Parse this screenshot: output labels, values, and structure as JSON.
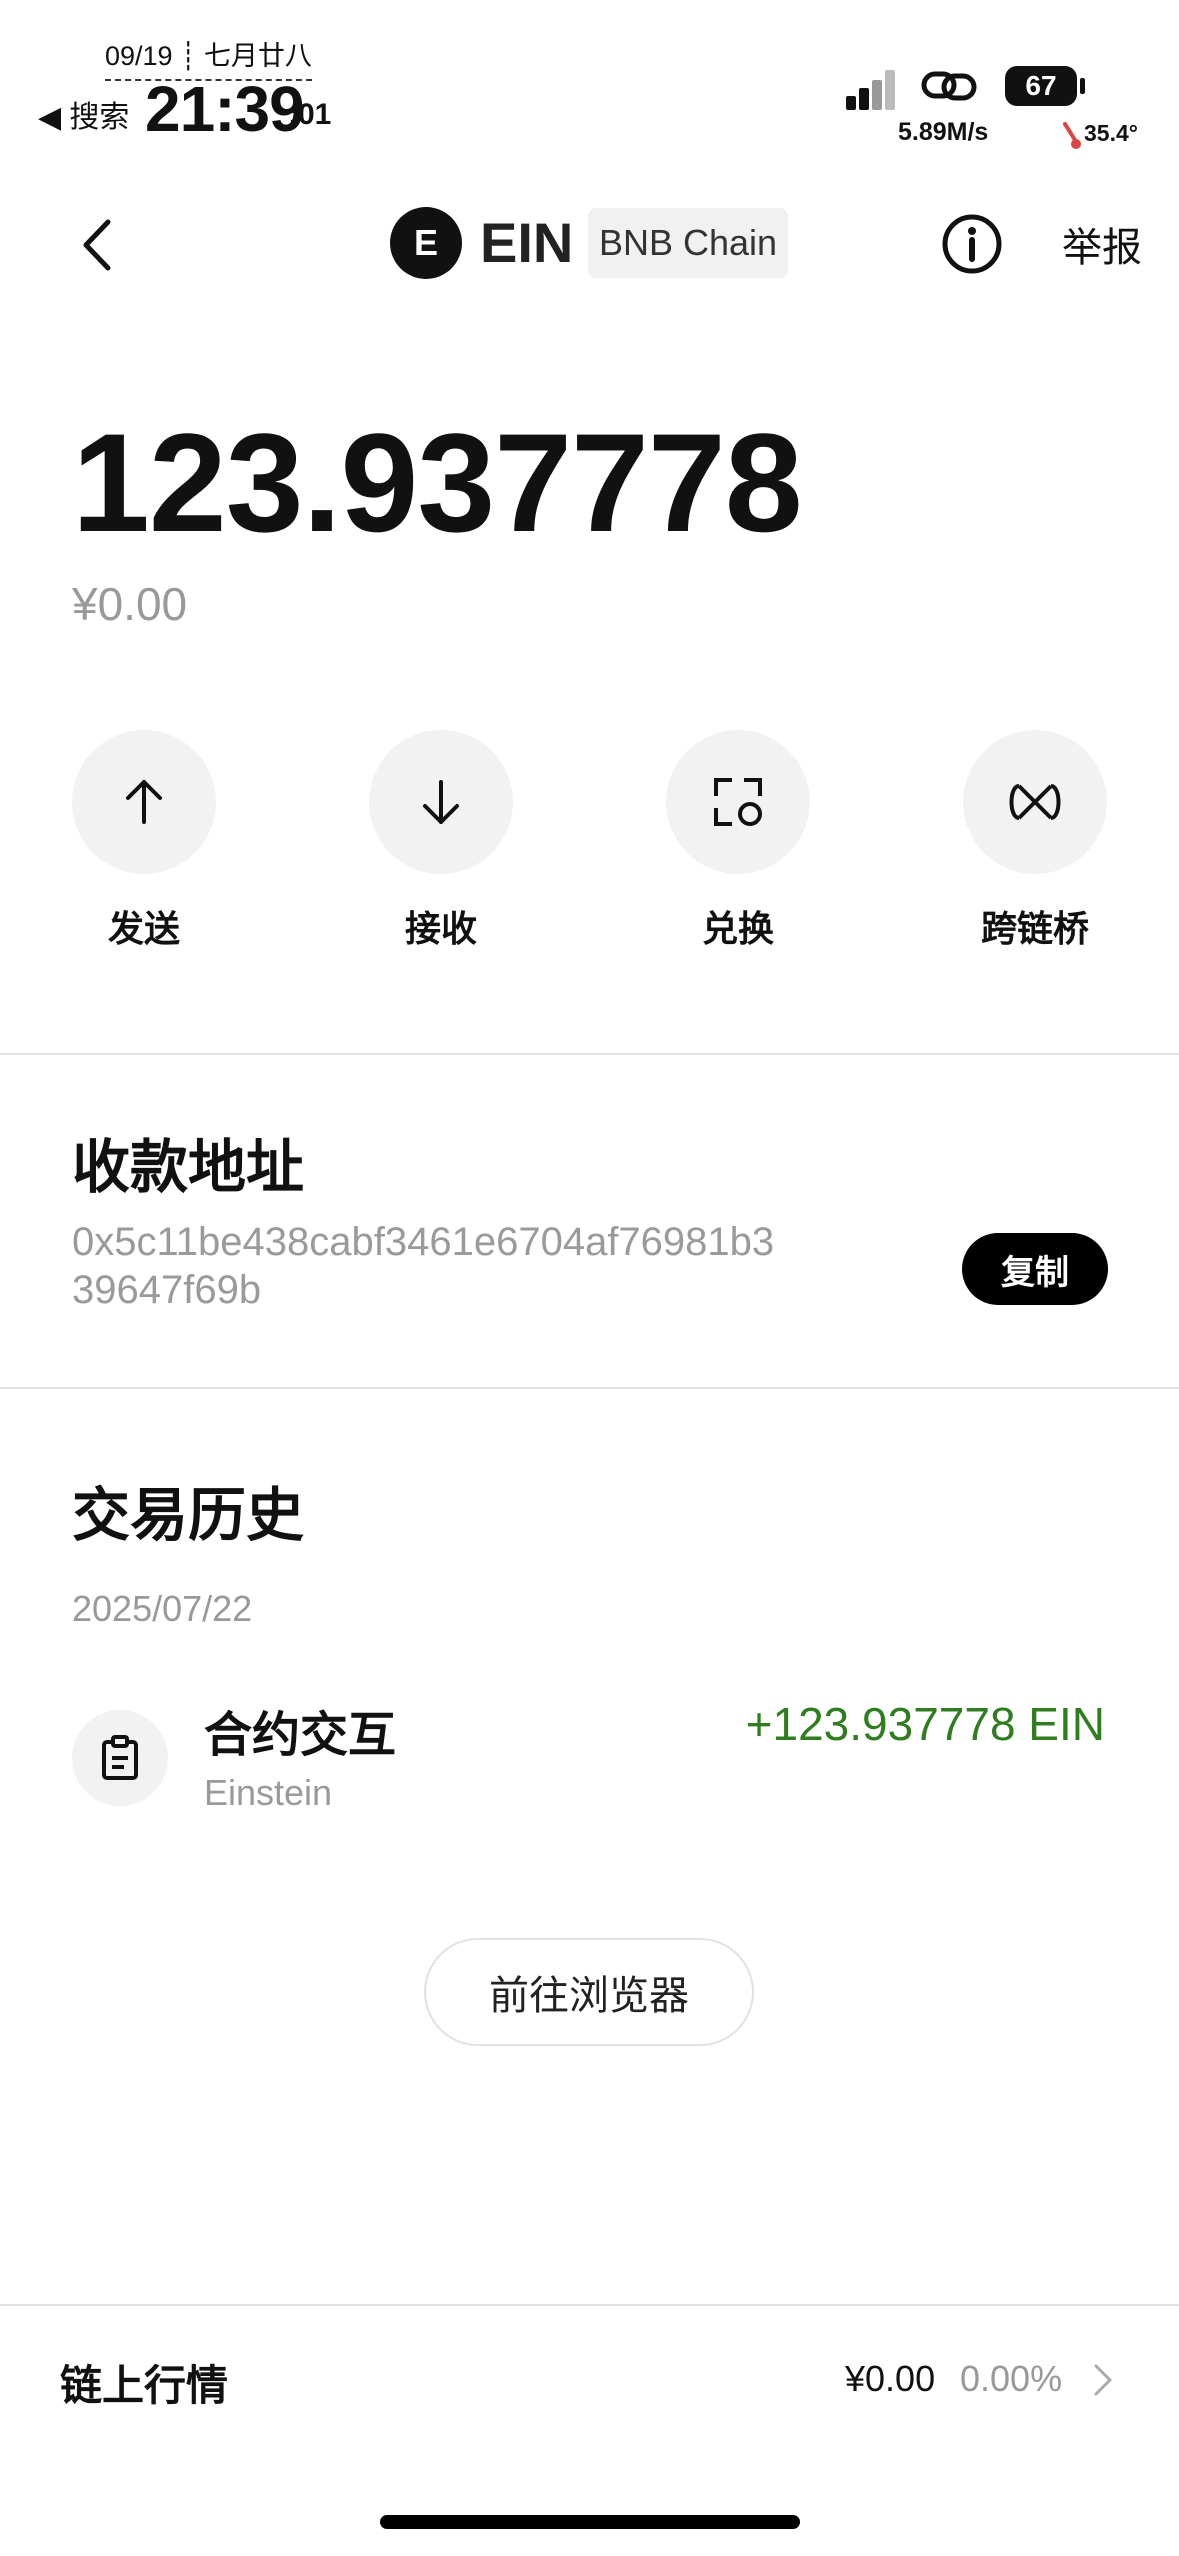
{
  "status_bar": {
    "date": "09/19 ┊ 七月廿八",
    "back_app": "◀ 搜索",
    "time": "21:39",
    "seconds": ":01",
    "network_speed": "5.89M/s",
    "battery": "67",
    "temperature": "35.4°"
  },
  "header": {
    "coin_logo_letter": "E",
    "coin_symbol": "EIN",
    "chain": "BNB Chain",
    "report": "举报"
  },
  "balance": {
    "amount": "123.937778",
    "fiat": "¥0.00"
  },
  "actions": [
    {
      "label": "发送",
      "icon": "arrow-up-icon"
    },
    {
      "label": "接收",
      "icon": "arrow-down-icon"
    },
    {
      "label": "兑换",
      "icon": "swap-icon"
    },
    {
      "label": "跨链桥",
      "icon": "bridge-icon"
    }
  ],
  "address_section": {
    "title": "收款地址",
    "address": "0x5c11be438cabf3461e6704af76981b339647f69b",
    "copy": "复制"
  },
  "history": {
    "title": "交易历史",
    "date": "2025/07/22",
    "items": [
      {
        "title": "合约交互",
        "subtitle": "Einstein",
        "amount": "+123.937778 EIN",
        "icon": "contract-icon"
      }
    ],
    "explorer_button": "前往浏览器"
  },
  "market": {
    "label": "链上行情",
    "price": "¥0.00",
    "change": "0.00%"
  },
  "colors": {
    "positive": "#2e7d1f",
    "muted": "#999999",
    "button_bg": "#f2f2f2"
  }
}
